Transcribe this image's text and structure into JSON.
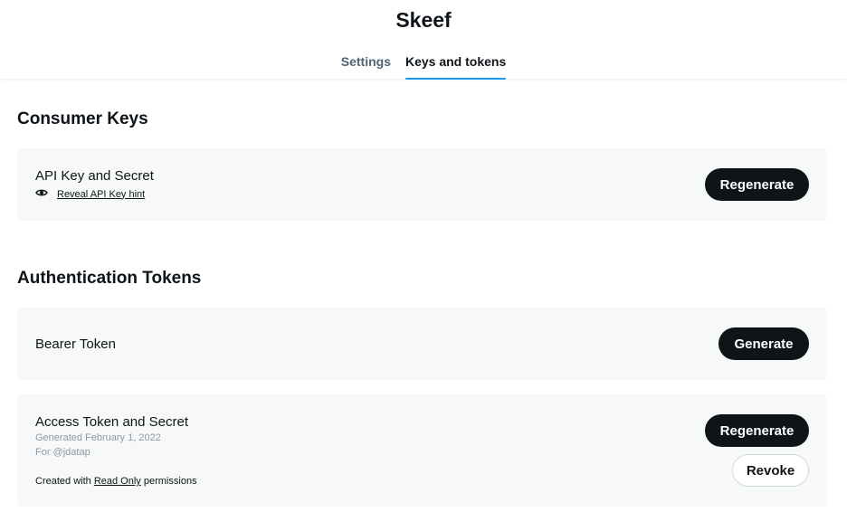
{
  "header": {
    "title": "Skeef",
    "tabs": [
      {
        "label": "Settings",
        "active": false
      },
      {
        "label": "Keys and tokens",
        "active": true
      }
    ]
  },
  "consumer_keys": {
    "heading": "Consumer Keys",
    "api_key": {
      "title": "API Key and Secret",
      "hint_link": "Reveal API Key hint",
      "hint_icon": "eye-icon",
      "button": "Regenerate"
    }
  },
  "auth_tokens": {
    "heading": "Authentication Tokens",
    "bearer": {
      "title": "Bearer Token",
      "button": "Generate"
    },
    "access": {
      "title": "Access Token and Secret",
      "generated": "Generated February 1, 2022",
      "for_user": "For @jdatap",
      "perm_prefix": "Created with",
      "perm_level": "Read Only",
      "perm_suffix": "permissions",
      "regenerate_button": "Regenerate",
      "revoke_button": "Revoke"
    }
  },
  "colors": {
    "accent": "#1d9bf0",
    "dark_button": "#0f1419",
    "card_bg": "#f7f9f9",
    "muted_text": "#8b98a5"
  }
}
